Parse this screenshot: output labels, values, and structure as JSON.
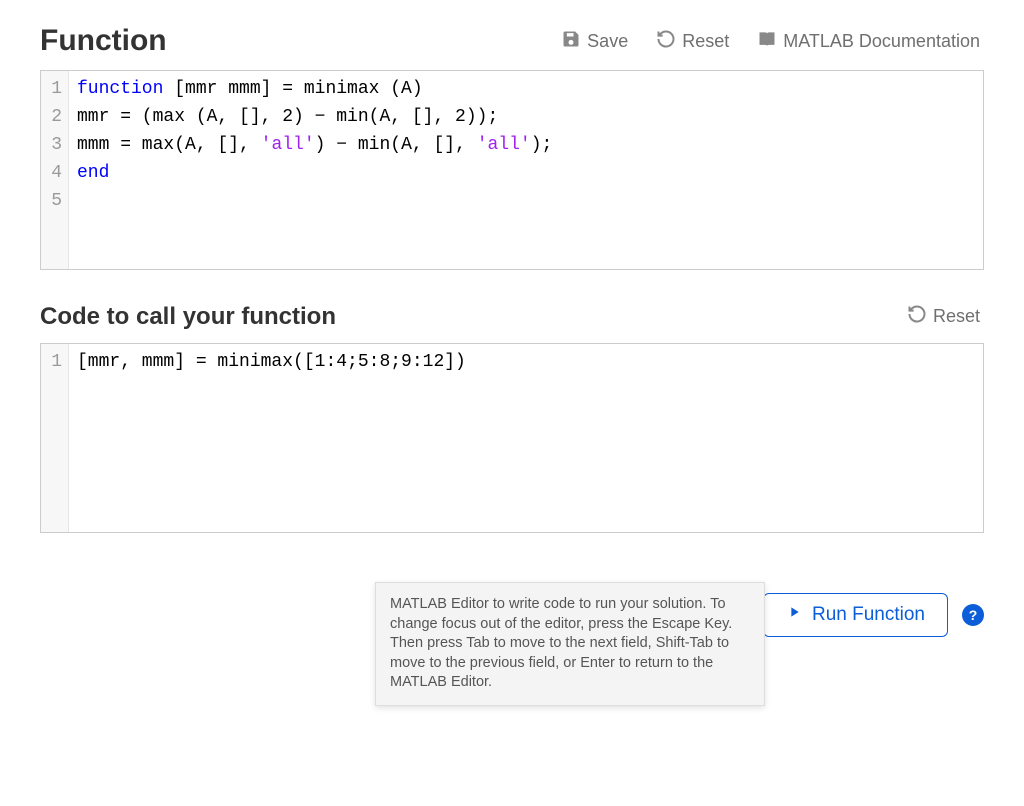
{
  "function_section": {
    "title": "Function",
    "toolbar": {
      "save_label": "Save",
      "reset_label": "Reset",
      "docs_label": "MATLAB Documentation"
    },
    "code_lines": [
      {
        "n": "1",
        "tokens": [
          {
            "t": "function",
            "cls": "tok-kw"
          },
          {
            "t": " [mmr mmm] = minimax (A)",
            "cls": "tok-plain"
          }
        ]
      },
      {
        "n": "2",
        "tokens": [
          {
            "t": "mmr = (max (A, [], 2) − min(A, [], 2));",
            "cls": "tok-plain"
          }
        ]
      },
      {
        "n": "3",
        "tokens": [
          {
            "t": "mmm = max(A, [], ",
            "cls": "tok-plain"
          },
          {
            "t": "'all'",
            "cls": "tok-str"
          },
          {
            "t": ") − min(A, [], ",
            "cls": "tok-plain"
          },
          {
            "t": "'all'",
            "cls": "tok-str"
          },
          {
            "t": ");",
            "cls": "tok-plain"
          }
        ]
      },
      {
        "n": "4",
        "tokens": [
          {
            "t": "end",
            "cls": "tok-kw"
          }
        ]
      },
      {
        "n": "5",
        "tokens": []
      }
    ]
  },
  "caller_section": {
    "title": "Code to call your function",
    "toolbar": {
      "reset_label": "Reset"
    },
    "code_lines": [
      {
        "n": "1",
        "tokens": [
          {
            "t": "[mmr, mmm] = minimax([1:4;5:8;9:12])",
            "cls": "tok-plain"
          }
        ]
      }
    ]
  },
  "tooltip": "MATLAB Editor to write code to run your solution. To change focus out of the editor, press the Escape Key. Then press Tab to move to the next field, Shift-Tab to move to the previous field, or Enter to return to the MATLAB Editor.",
  "footer": {
    "run_label": "Run Function",
    "help_label": "?"
  }
}
